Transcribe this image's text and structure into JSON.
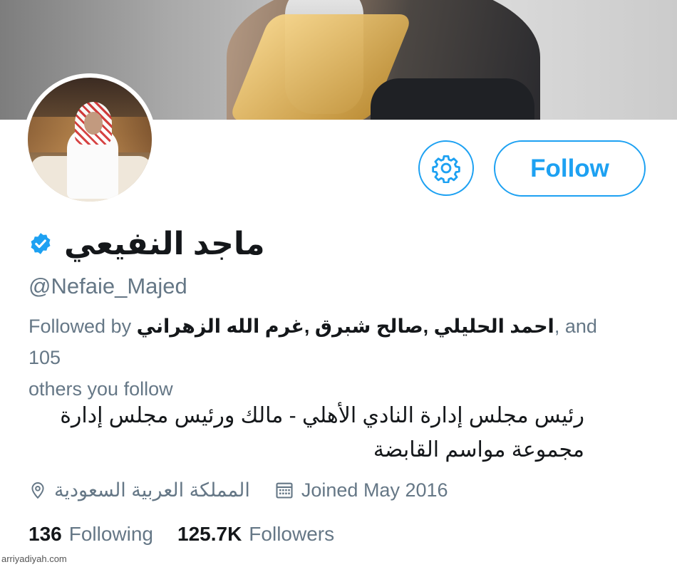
{
  "profile": {
    "display_name": "ماجد النفيعي",
    "handle": "@Nefaie_Majed",
    "verified": true,
    "followed_by": {
      "prefix": "Followed by",
      "names": "احمد الحليلي ,صالح شبرق ,غرم الله الزهراني",
      "suffix": ", and 105",
      "second_line": "others you follow"
    },
    "bio_line1": "رئيس مجلس إدارة النادي الأهلي - مالك ورئيس مجلس إدارة",
    "bio_line2": "مجموعة مواسم القابضة",
    "location": "المملكة العربية السعودية",
    "joined": "Joined May 2016",
    "following_count": "136",
    "following_label": "Following",
    "followers_count": "125.7K",
    "followers_label": "Followers"
  },
  "actions": {
    "follow_label": "Follow",
    "settings_icon": "gear-icon"
  },
  "watermark": "arriyadiyah.com",
  "colors": {
    "accent": "#1da1f2",
    "secondary_text": "#657786",
    "primary_text": "#14171a"
  }
}
